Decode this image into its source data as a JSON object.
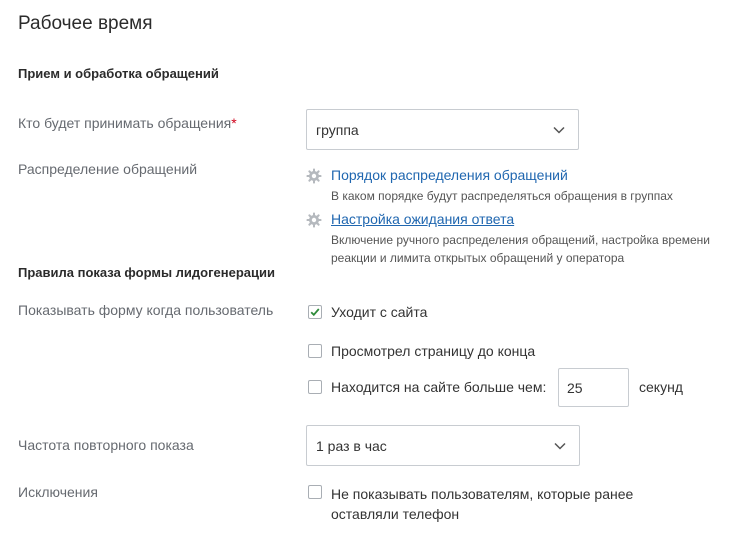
{
  "page": {
    "title": "Рабочее время"
  },
  "sections": {
    "handling": "Прием и обработка обращений",
    "leadgen": "Правила показа формы лидогенерации"
  },
  "who_accepts": {
    "label": "Кто будет принимать обращения",
    "required_mark": "*",
    "value": "группа"
  },
  "distribution": {
    "label": "Распределение обращений",
    "links": [
      {
        "label": "Порядок распределения обращений",
        "hint": "В каком порядке будут распределяться обращения в группах"
      },
      {
        "label": "Настройка ожидания ответа",
        "hint": "Включение ручного распределения обращений, настройка времени реакции и лимита открытых обращений у оператора"
      }
    ]
  },
  "show_form": {
    "label": "Показывать форму когда пользователь",
    "options": [
      {
        "label": "Уходит с сайта",
        "checked": true
      },
      {
        "label": "Просмотрел страницу до конца",
        "checked": false
      },
      {
        "label": "Находится на сайте больше чем:",
        "checked": false
      }
    ],
    "seconds_value": "25",
    "seconds_unit": "секунд"
  },
  "repeat_frequency": {
    "label": "Частота повторного показа",
    "value": "1 раз в час"
  },
  "exclusions": {
    "label": "Исключения",
    "option": {
      "label": "Не показывать пользователям, которые ранее оставляли телефон",
      "checked": false
    }
  },
  "colors": {
    "link": "#2067b0",
    "check": "#2e8b3a",
    "required": "#d0021b",
    "gear": "#b5b9be"
  }
}
